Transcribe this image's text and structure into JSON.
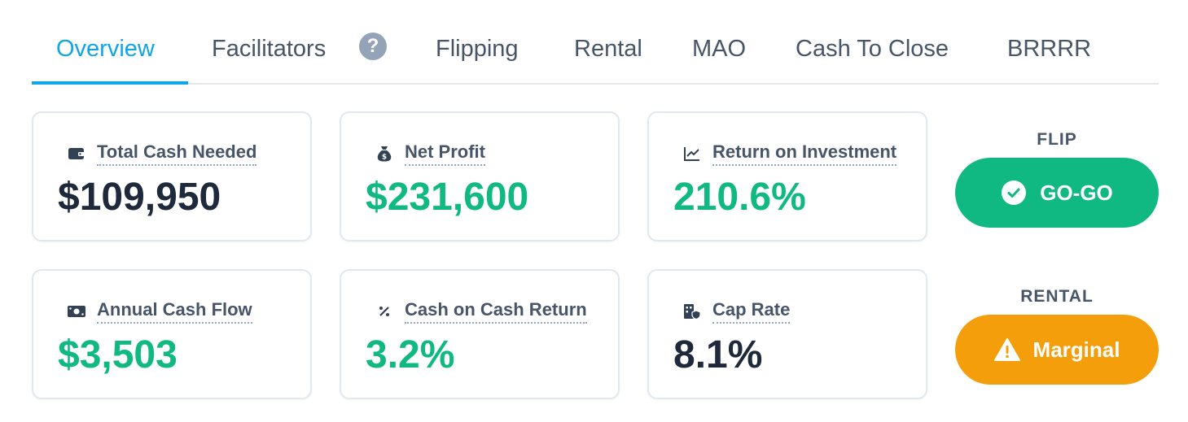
{
  "tabs": [
    {
      "label": "Overview",
      "active": true
    },
    {
      "label": "Facilitators",
      "help_badge": "?"
    },
    {
      "label": "Flipping"
    },
    {
      "label": "Rental"
    },
    {
      "label": "MAO"
    },
    {
      "label": "Cash To Close"
    },
    {
      "label": "BRRRR"
    }
  ],
  "metrics": [
    {
      "label": "Total Cash Needed",
      "value": "$109,950",
      "icon": "wallet-icon",
      "color": "#1e293b"
    },
    {
      "label": "Net Profit",
      "value": "$231,600",
      "icon": "money-bag-icon",
      "color": "#10b981"
    },
    {
      "label": "Return on Investment",
      "value": "210.6%",
      "icon": "chart-line-icon",
      "color": "#10b981"
    },
    {
      "label": "Annual Cash Flow",
      "value": "$3,503",
      "icon": "cash-bill-icon",
      "color": "#10b981"
    },
    {
      "label": "Cash on Cash Return",
      "value": "3.2%",
      "icon": "percent-icon",
      "color": "#10b981"
    },
    {
      "label": "Cap Rate",
      "value": "8.1%",
      "icon": "building-shield-icon",
      "color": "#1e293b"
    }
  ],
  "verdicts": {
    "flip": {
      "title": "FLIP",
      "label": "GO-GO",
      "icon": "check-circle-icon",
      "color": "#10b981"
    },
    "rental": {
      "title": "RENTAL",
      "label": "Marginal",
      "icon": "warning-icon",
      "color": "#f59e0b"
    }
  },
  "colors": {
    "accent": "#0ea5e9",
    "text": "#1e293b",
    "muted": "#475569",
    "positive": "#10b981",
    "warning": "#f59e0b"
  }
}
